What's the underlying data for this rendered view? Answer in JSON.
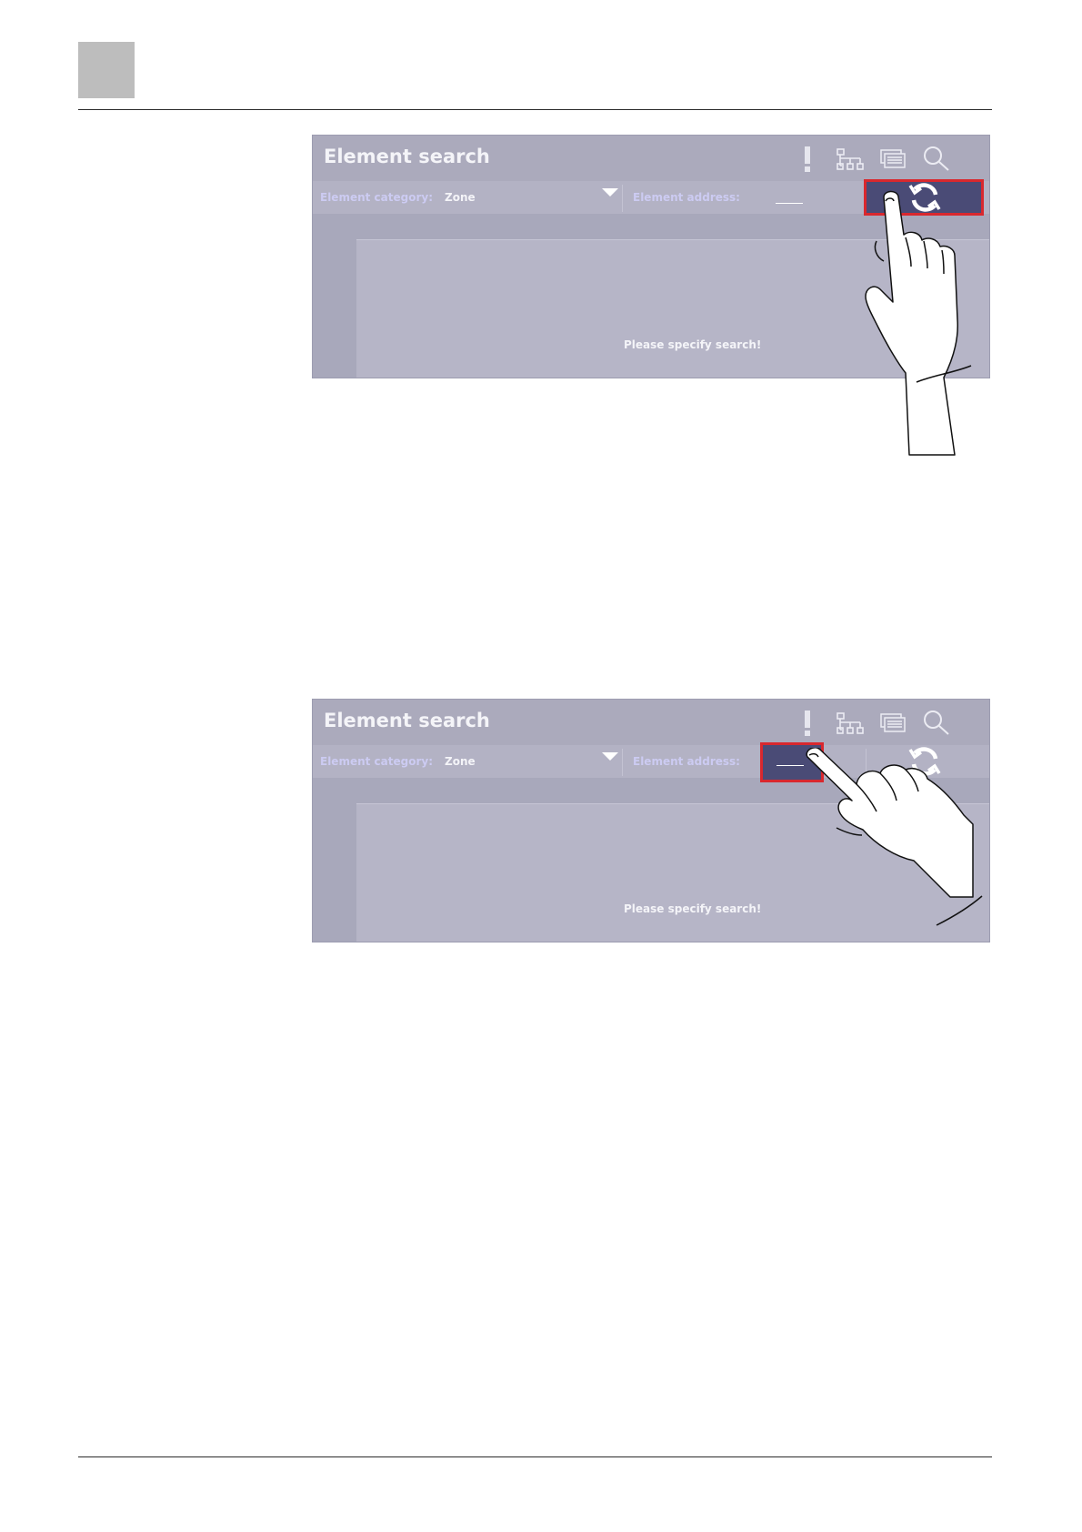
{
  "figures": [
    {
      "title": "Element search",
      "icons": [
        "alert-icon",
        "tree-icon",
        "documents-icon",
        "magnifier-icon"
      ],
      "filter": {
        "category_label": "Element category:",
        "category_value": "Zone",
        "address_label": "Element address:",
        "address_value": "___"
      },
      "refresh_icon": "refresh-icon",
      "highlighted": "refresh-button",
      "result_text": "Please specify search!"
    },
    {
      "title": "Element search",
      "icons": [
        "alert-icon",
        "tree-icon",
        "documents-icon",
        "magnifier-icon"
      ],
      "filter": {
        "category_label": "Element category:",
        "category_value": "Zone",
        "address_label": "Element address:",
        "address_value": "___"
      },
      "refresh_icon": "refresh-icon",
      "highlighted": "element-address-field",
      "result_text": "Please specify search!"
    }
  ],
  "colors": {
    "screen_bg": "#a8a8bb",
    "highlight_border": "#d9282e",
    "button_fill": "#4a4b76",
    "label_text": "#cccbf2"
  }
}
